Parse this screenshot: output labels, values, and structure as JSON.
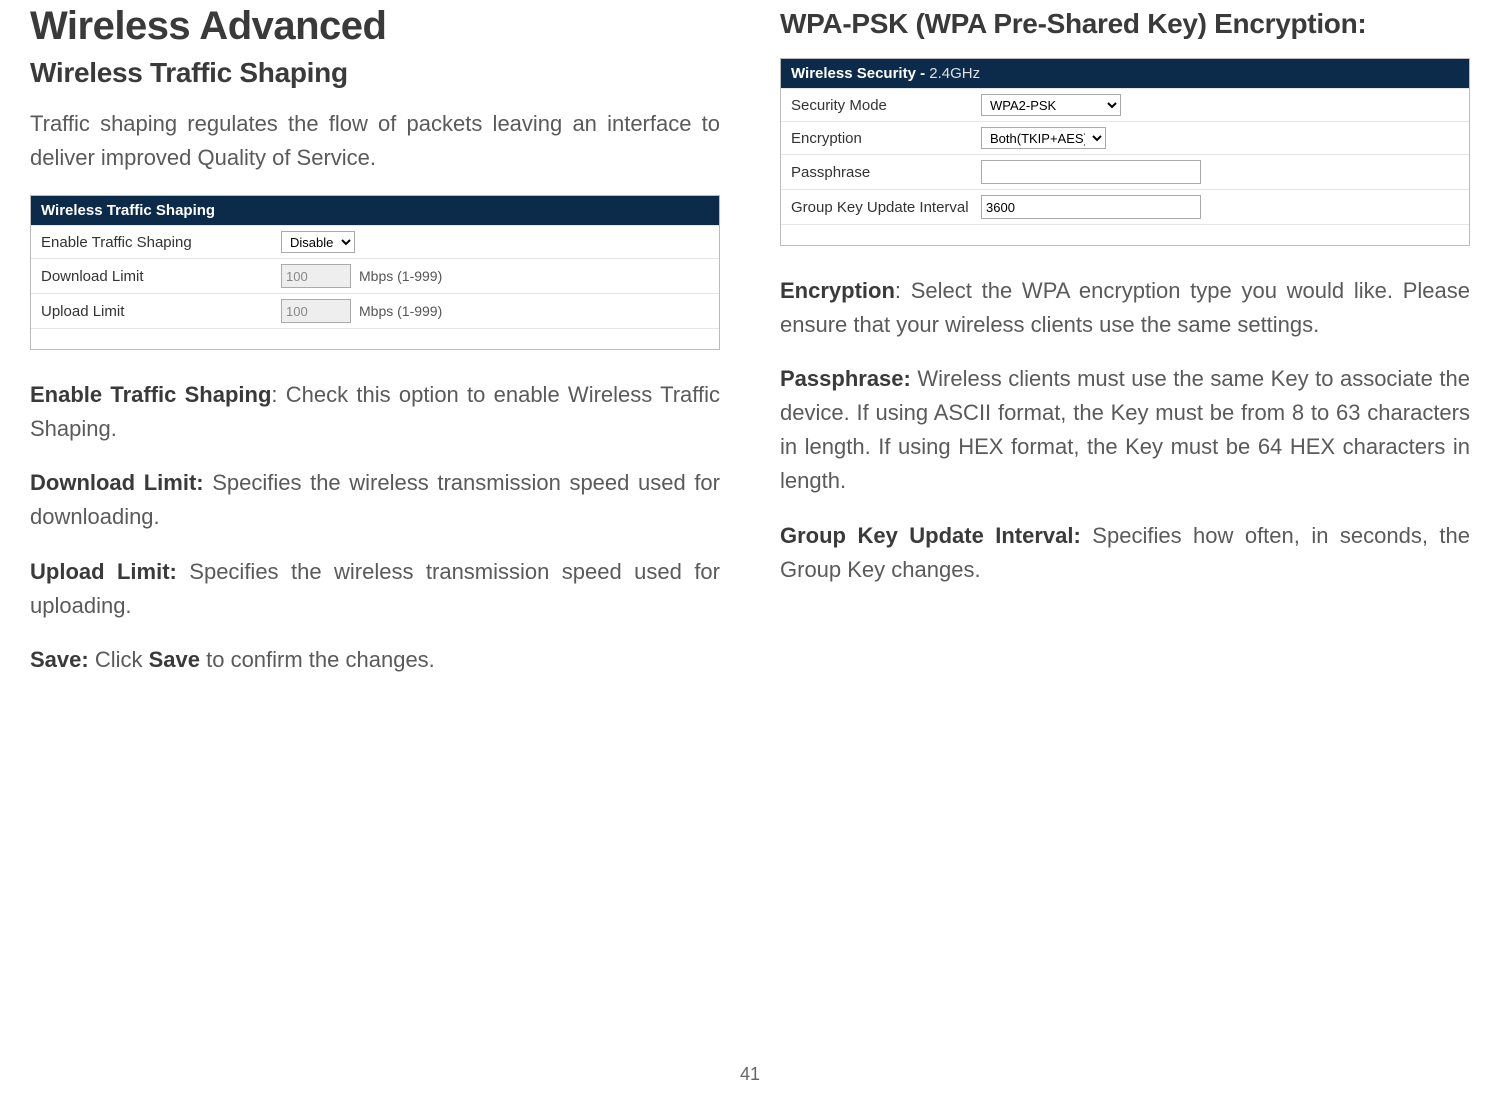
{
  "left": {
    "h1": "Wireless Advanced",
    "h2": "Wireless Traffic Shaping",
    "intro": "Traffic shaping regulates the flow of packets leaving an interface to deliver improved Quality of Service.",
    "table": {
      "header": "Wireless Traffic Shaping",
      "rows": {
        "enable_label": "Enable Traffic Shaping",
        "enable_value": "Disable",
        "dl_label": "Download Limit",
        "dl_value": "100",
        "dl_hint": "Mbps (1-999)",
        "ul_label": "Upload Limit",
        "ul_value": "100",
        "ul_hint": "Mbps (1-999)"
      }
    },
    "defs": {
      "enable_b": "Enable Traffic Shaping",
      "enable_t": ": Check this option to enable Wireless Traffic Shaping.",
      "dl_b": "Download Limit:",
      "dl_t": " Specifies the wireless transmission speed used for downloading.",
      "ul_b": "Upload Limit:",
      "ul_t": " Specifies the wireless transmission speed used for uploading.",
      "save_b": "Save:",
      "save_t1": " Click ",
      "save_b2": "Save",
      "save_t2": " to confirm the changes."
    }
  },
  "right": {
    "h2": "WPA-PSK (WPA Pre-Shared Key) Encryption:",
    "table": {
      "header_a": "Wireless Security - ",
      "header_b": "2.4GHz",
      "rows": {
        "mode_label": "Security Mode",
        "mode_value": "WPA2-PSK",
        "enc_label": "Encryption",
        "enc_value": "Both(TKIP+AES)",
        "pass_label": "Passphrase",
        "pass_value": "",
        "gku_label": "Group Key Update Interval",
        "gku_value": "3600"
      }
    },
    "defs": {
      "enc_b": "Encryption",
      "enc_t": ": Select the WPA encryption type you would like. Please ensure that your wireless clients use the same settings.",
      "pass_b": "Passphrase:",
      "pass_t": " Wireless clients must use the same Key to associate the device. If using ASCII format, the Key must be from 8 to 63 characters in length. If using HEX format, the Key must be 64 HEX characters in length.",
      "gku_b": "Group Key Update Interval:",
      "gku_t": " Specifies how often, in seconds, the Group Key changes."
    }
  },
  "page_number": "41"
}
